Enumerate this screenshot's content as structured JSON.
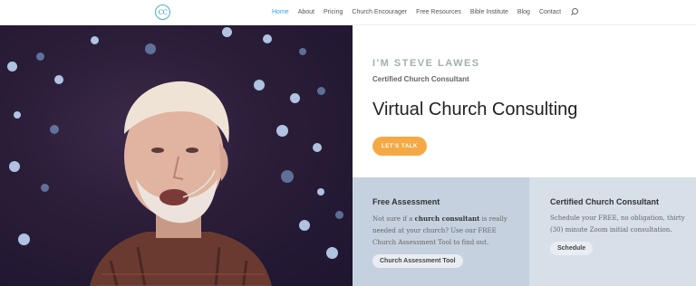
{
  "header": {
    "logo_text": "CC",
    "nav": [
      {
        "label": "Home",
        "active": true
      },
      {
        "label": "About"
      },
      {
        "label": "Pricing"
      },
      {
        "label": "Church Encourager"
      },
      {
        "label": "Free Resources"
      },
      {
        "label": "Bible Institute"
      },
      {
        "label": "Blog"
      },
      {
        "label": "Contact"
      }
    ],
    "search_icon": "search-icon"
  },
  "hero": {
    "kicker": "I'M STEVE LAWES",
    "subtitle": "Certified Church Consultant",
    "title": "Virtual Church Consulting",
    "cta_label": "LET'S TALK"
  },
  "cards": {
    "assessment": {
      "title": "Free Assessment",
      "text_before": "Not sure if a ",
      "text_bold": "church consultant",
      "text_after": " is really needed at your church? Use our FREE Church Assessment Tool to find out.",
      "button_label": "Church Assessment Tool"
    },
    "consultant": {
      "title": "Certified Church Consultant",
      "text": "Schedule your FREE, no obligation, thirty (30) minute Zoom initial consultation.",
      "button_label": "Schedule"
    }
  },
  "colors": {
    "accent_nav": "#2ea3f2",
    "cta": "#f5a945",
    "card_left": "#c6d1df",
    "card_right": "#d7dfe9"
  }
}
